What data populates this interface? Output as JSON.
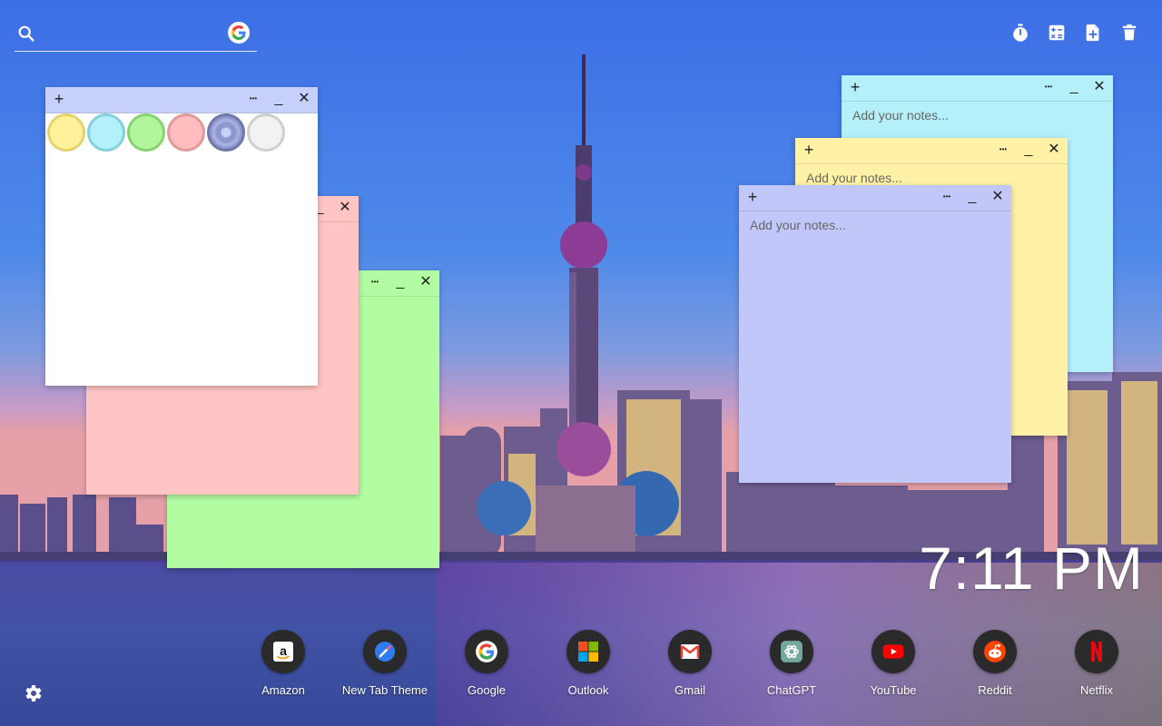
{
  "search": {
    "placeholder": "",
    "value": ""
  },
  "toolbar": {
    "icons": [
      "timer-icon",
      "calculator-icon",
      "add-note-icon",
      "trash-icon"
    ]
  },
  "notes": [
    {
      "id": "yellow",
      "color": "#fff2a6",
      "placeholder": "Add your notes...",
      "value": ""
    },
    {
      "id": "cyan",
      "color": "#b4f0fa",
      "placeholder": "Add your notes...",
      "value": ""
    },
    {
      "id": "blue",
      "color": "#c1c8f9",
      "placeholder": "Add your notes...",
      "value": ""
    },
    {
      "id": "pink",
      "color": "#ffc4c4",
      "placeholder": "",
      "value": ""
    },
    {
      "id": "green",
      "color": "#b2fca1",
      "placeholder": "",
      "value": ""
    },
    {
      "id": "white",
      "color": "#ffffff",
      "placeholder": "",
      "value": ""
    }
  ],
  "palette": [
    {
      "name": "yellow",
      "fill": "#fff29a",
      "ring": "#e4d36e"
    },
    {
      "name": "cyan",
      "fill": "#b4f0fa",
      "ring": "#84cfe0"
    },
    {
      "name": "green",
      "fill": "#b2f59c",
      "ring": "#84d470"
    },
    {
      "name": "pink",
      "fill": "#ffbdbd",
      "ring": "#e49a9a"
    },
    {
      "name": "purple",
      "fill": "#8e98cc",
      "ring": "#6f78a8",
      "selected": true
    },
    {
      "name": "white",
      "fill": "#f2f2f2",
      "ring": "#cfcfcf"
    }
  ],
  "note_controls": {
    "add": "+",
    "more": "•••",
    "minimize": "_",
    "close": "✕"
  },
  "clock": {
    "time": "7:11 PM"
  },
  "shortcuts": [
    {
      "label": "Amazon",
      "icon": "amazon-icon"
    },
    {
      "label": "New Tab Theme",
      "icon": "new-tab-theme-icon"
    },
    {
      "label": "Google",
      "icon": "google-icon"
    },
    {
      "label": "Outlook",
      "icon": "outlook-icon"
    },
    {
      "label": "Gmail",
      "icon": "gmail-icon"
    },
    {
      "label": "ChatGPT",
      "icon": "chatgpt-icon"
    },
    {
      "label": "YouTube",
      "icon": "youtube-icon"
    },
    {
      "label": "Reddit",
      "icon": "reddit-icon"
    },
    {
      "label": "Netflix",
      "icon": "netflix-icon"
    }
  ],
  "settings": {
    "icon": "gear-icon"
  }
}
